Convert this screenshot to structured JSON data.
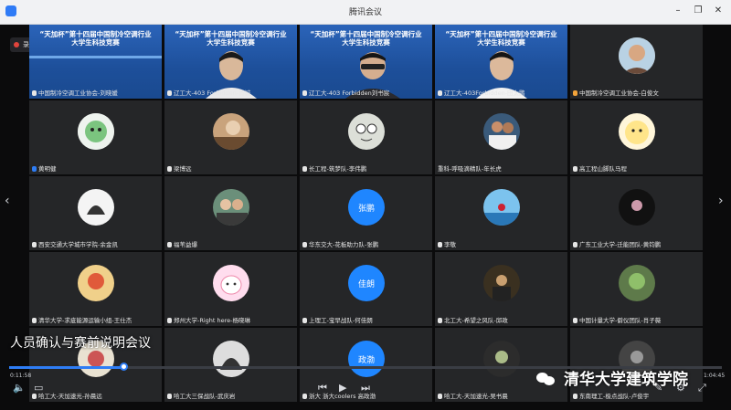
{
  "window": {
    "title": "腾讯会议"
  },
  "recording": {
    "label": "录制中"
  },
  "slide": {
    "title_line1": "“天加杯”第十四届中国制冷空调行业",
    "title_line2": "大学生科技竞赛"
  },
  "tiles": [
    {
      "name": "中国制冷空调工业协会-刘晓媛",
      "kind": "slide",
      "muted": true
    },
    {
      "name": "辽工大-403 Forbidden-肖诚",
      "kind": "slide_person",
      "muted": true
    },
    {
      "name": "辽工大-403 Forbidden刘书宸",
      "kind": "slide_person",
      "muted": true
    },
    {
      "name": "辽工大-403Forbidden-田太鹏",
      "kind": "slide_person",
      "muted": true
    },
    {
      "name": "中国制冷空调工业协会-白俊文",
      "kind": "avatar",
      "muted": true
    },
    {
      "name": "黄明健",
      "kind": "avatar",
      "muted": true
    },
    {
      "name": "梁博远",
      "kind": "avatar",
      "muted": true
    },
    {
      "name": "长工程-筑梦队-李伟鹏",
      "kind": "avatar",
      "muted": true
    },
    {
      "name": "重科-呼吸滴精队-年长虎",
      "kind": "avatar",
      "muted": false
    },
    {
      "name": "高工程山脚队马程",
      "kind": "avatar",
      "muted": true
    },
    {
      "name": "西安交通大学城市学院-余金凯",
      "kind": "avatar",
      "muted": true
    },
    {
      "name": "福苇益爆",
      "kind": "avatar",
      "muted": true
    },
    {
      "name": "华东交大-花板助力队-张鹏",
      "kind": "text",
      "label": "张鹏",
      "muted": true
    },
    {
      "name": "李敬",
      "kind": "avatar",
      "muted": true
    },
    {
      "name": "广东工业大学-迁能团队-黄钧鹏",
      "kind": "avatar",
      "muted": true
    },
    {
      "name": "清华大学-求疵能源运输小组-王仕杰",
      "kind": "avatar",
      "muted": true
    },
    {
      "name": "郑州大学-Right here-杨晓琳",
      "kind": "avatar",
      "muted": true
    },
    {
      "name": "上理工-宝早战队-何佳朗",
      "kind": "text",
      "label": "佳朗",
      "muted": true
    },
    {
      "name": "北工大-希望之风队-邱政",
      "kind": "avatar",
      "muted": true
    },
    {
      "name": "中国计量大学-僻仪团队-肖子薇",
      "kind": "avatar",
      "muted": true
    },
    {
      "name": "哈工大-天加速光-孙晨远",
      "kind": "avatar",
      "muted": true
    },
    {
      "name": "哈工大三保战队-武庆岩",
      "kind": "avatar",
      "muted": true
    },
    {
      "name": "浙大 浙大coolers 高政渤",
      "kind": "text",
      "label": "政渤",
      "muted": true
    },
    {
      "name": "哈工大-天加速光-吴书晨",
      "kind": "avatar",
      "muted": true
    },
    {
      "name": "东南理工-极点战队-卢俊宇",
      "kind": "avatar",
      "muted": true
    }
  ],
  "subtitle": "人员确认与赛前说明会议",
  "player": {
    "elapsed": "0:11:58",
    "total": "1:04:45",
    "progress": 0.16
  },
  "watermark": "清华大学建筑学院",
  "colors": {
    "accent": "#2e7df5",
    "avatar_blue": "#1f86ff",
    "tile_bg": "#252628"
  },
  "icons": [
    "volume-icon",
    "subtitle-icon",
    "prev-icon",
    "play-icon",
    "next-icon",
    "settings-icon",
    "fullscreen-icon",
    "wechat-icon",
    "chevron-left-icon",
    "chevron-right-icon"
  ]
}
